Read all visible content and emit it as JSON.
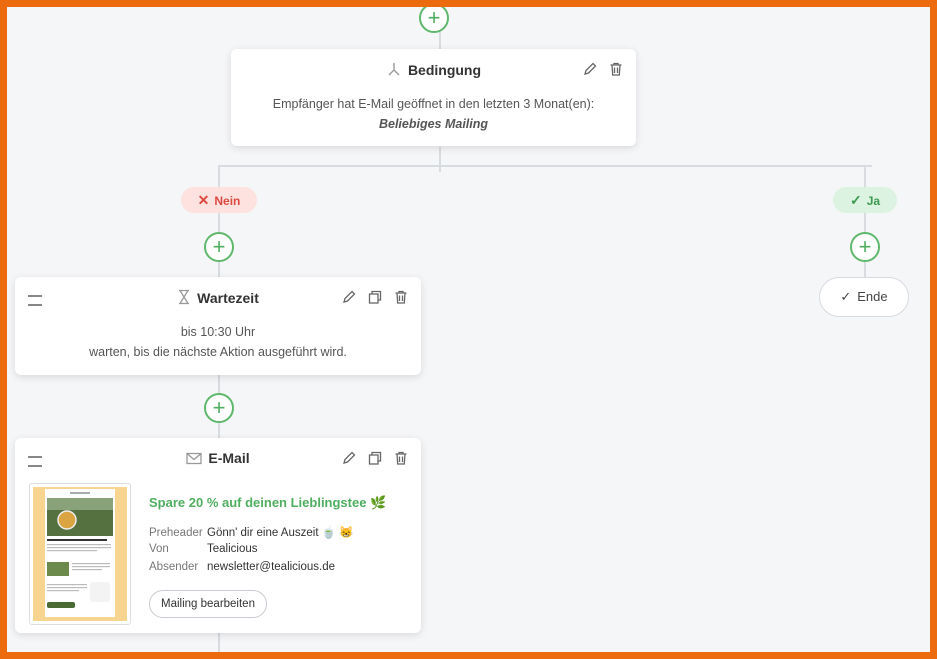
{
  "condition": {
    "title": "Bedingung",
    "line1": "Empfänger hat E-Mail geöffnet in den letzten 3 Monat(en):",
    "line2": "Beliebiges Mailing"
  },
  "branches": {
    "no_label": "Nein",
    "yes_label": "Ja"
  },
  "wait": {
    "title": "Wartezeit",
    "line1": "bis 10:30 Uhr",
    "line2": "warten, bis die nächste Aktion ausgeführt wird."
  },
  "end": {
    "label": "Ende"
  },
  "email": {
    "title": "E-Mail",
    "subject": "Spare 20 % auf deinen Lieblingstee 🌿",
    "preheader_label": "Preheader",
    "preheader_value": "Gönn' dir eine Auszeit 🍵 😸",
    "from_label": "Von",
    "from_value": "Tealicious",
    "sender_label": "Absender",
    "sender_value": "newsletter@tealicious.de",
    "edit_button": "Mailing bearbeiten"
  },
  "colors": {
    "frame": "#ec6b0f",
    "plus": "#4fae5f",
    "no": "#dd4a3f",
    "yes": "#3c9a4e",
    "subject": "#4fae5f"
  },
  "icons": {
    "add": "plus-circle-icon",
    "edit": "pencil-icon",
    "delete": "trash-icon",
    "copy": "copy-icon",
    "drag": "drag-handle-icon",
    "condition": "branch-icon",
    "wait": "hourglass-icon",
    "email": "envelope-icon"
  }
}
